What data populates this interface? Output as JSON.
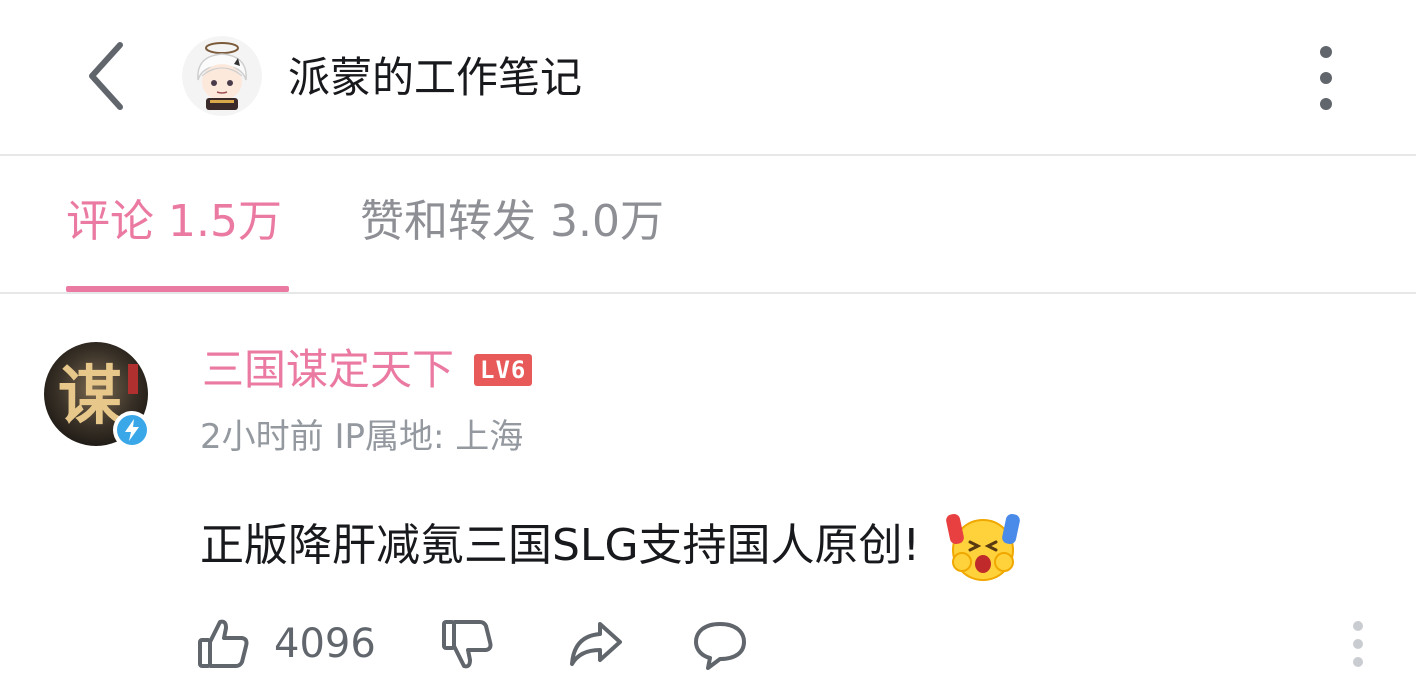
{
  "header": {
    "title": "派蒙的工作笔记",
    "icons": {
      "back": "chevron-left-icon",
      "more": "more-vertical-icon"
    }
  },
  "tabs": [
    {
      "label": "评论 1.5万",
      "active": true
    },
    {
      "label": "赞和转发 3.0万",
      "active": false
    }
  ],
  "comment": {
    "username": "三国谋定天下",
    "level": "LV6",
    "meta": "2小时前 IP属地: 上海",
    "text": "正版降肝减氪三国SLG支持国人原创!",
    "emoji": "cheering-face-emoji",
    "like_count": "4096",
    "icons": [
      "thumb-up-icon",
      "thumb-down-icon",
      "share-icon",
      "reply-icon",
      "more-vertical-icon"
    ]
  },
  "colors": {
    "accent_pink": "#eb7aa2",
    "level_red": "#e85a5a",
    "verify_blue": "#3aa8e8",
    "muted_text": "#9499a0"
  }
}
